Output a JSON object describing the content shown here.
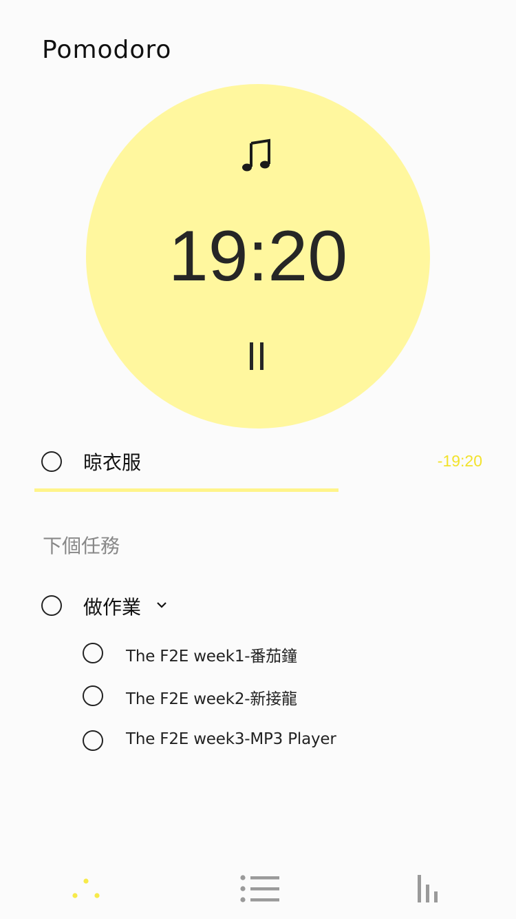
{
  "app": {
    "title": "Pomodoro"
  },
  "timer": {
    "display": "19:20",
    "music_icon": "music-note-icon",
    "pause_icon": "pause-icon",
    "accent_color": "#fff79e"
  },
  "current_task": {
    "label": "晾衣服",
    "remaining": "-19:20",
    "progress": 0.68,
    "progress_color": "#fff48a",
    "remaining_color": "#f2e22c"
  },
  "next_section": {
    "title": "下個任務"
  },
  "next_task": {
    "label": "做作業",
    "expand_icon": "chevron-down-icon",
    "subtasks": [
      {
        "label": "The F2E week1-番茄鐘"
      },
      {
        "label": "The F2E week2-新接龍"
      },
      {
        "label": "The F2E week3-MP3 Player"
      }
    ]
  },
  "nav": {
    "items": [
      {
        "icon": "timer-dots-icon",
        "active": true
      },
      {
        "icon": "list-icon",
        "active": false
      },
      {
        "icon": "bar-chart-icon",
        "active": false
      }
    ],
    "active_color": "#f7ea4a",
    "inactive_color": "#9a9a9a"
  }
}
